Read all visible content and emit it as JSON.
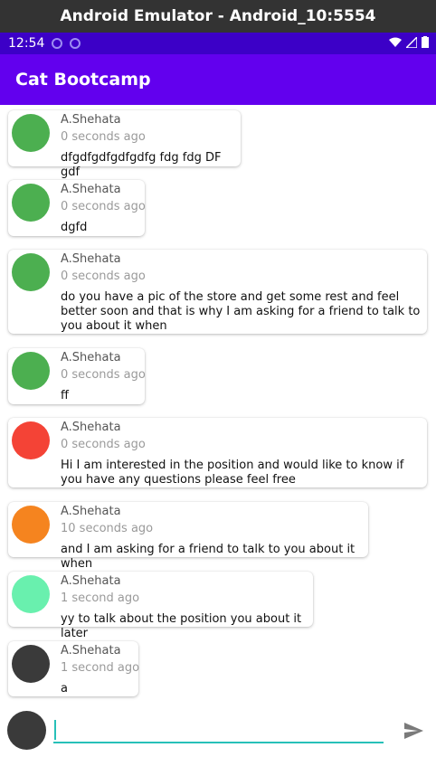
{
  "window": {
    "title": "Android Emulator - Android_10:5554"
  },
  "status_bar": {
    "time": "12:54"
  },
  "app_bar": {
    "title": "Cat Bootcamp"
  },
  "messages": [
    {
      "author": "A.Shehata",
      "time": "0 seconds ago",
      "text": "dfgdfgdfgdfgdfg fdg fdg DF gdf",
      "avatar_color": "#4caf50"
    },
    {
      "author": "A.Shehata",
      "time": "0 seconds ago",
      "text": "dgfd",
      "avatar_color": "#4caf50"
    },
    {
      "author": "A.Shehata",
      "time": "0 seconds ago",
      "text": "do you have a pic of the store and get some rest and feel better soon and that is why I am asking for a friend to talk to you about it when",
      "avatar_color": "#4caf50"
    },
    {
      "author": "A.Shehata",
      "time": "0 seconds ago",
      "text": "ff",
      "avatar_color": "#4caf50"
    },
    {
      "author": "A.Shehata",
      "time": "0 seconds ago",
      "text": "Hi I am interested in the position and would like to know if you have any questions please feel free",
      "avatar_color": "#f44336"
    },
    {
      "author": "A.Shehata",
      "time": "10 seconds ago",
      "text": "and I am asking for a friend to talk to you about it when",
      "avatar_color": "#f5841f"
    },
    {
      "author": "A.Shehata",
      "time": "1 second ago",
      "text": "yy to talk about the position you about it later",
      "avatar_color": "#69f0ae"
    },
    {
      "author": "A.Shehata",
      "time": "1 second ago",
      "text": "a",
      "avatar_color": "#3a3a3a"
    }
  ],
  "composer": {
    "value": "",
    "placeholder": ""
  },
  "colors": {
    "primary": "#6200ee",
    "primary_dark": "#3c00c7",
    "accent": "#27c0b8"
  }
}
